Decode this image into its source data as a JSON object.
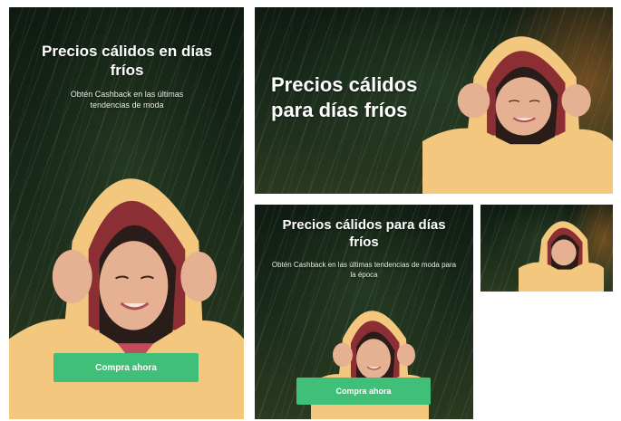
{
  "banners": {
    "tall": {
      "headline": "Precios cálidos en días fríos",
      "subtext": "Obtén Cashback en las últimas tendencias de moda",
      "cta_label": "Compra ahora"
    },
    "wide": {
      "headline": "Precios cálidos para días fríos"
    },
    "medium": {
      "headline": "Precios cálidos para días fríos",
      "subtext": "Obtén Cashback en las últimas tendencias de moda para la época",
      "cta_label": "Compra ahora"
    },
    "small": {}
  },
  "colors": {
    "cta": "#3fbf77",
    "jacket": "#f4c77e",
    "hood_inner": "#8b2f35"
  }
}
